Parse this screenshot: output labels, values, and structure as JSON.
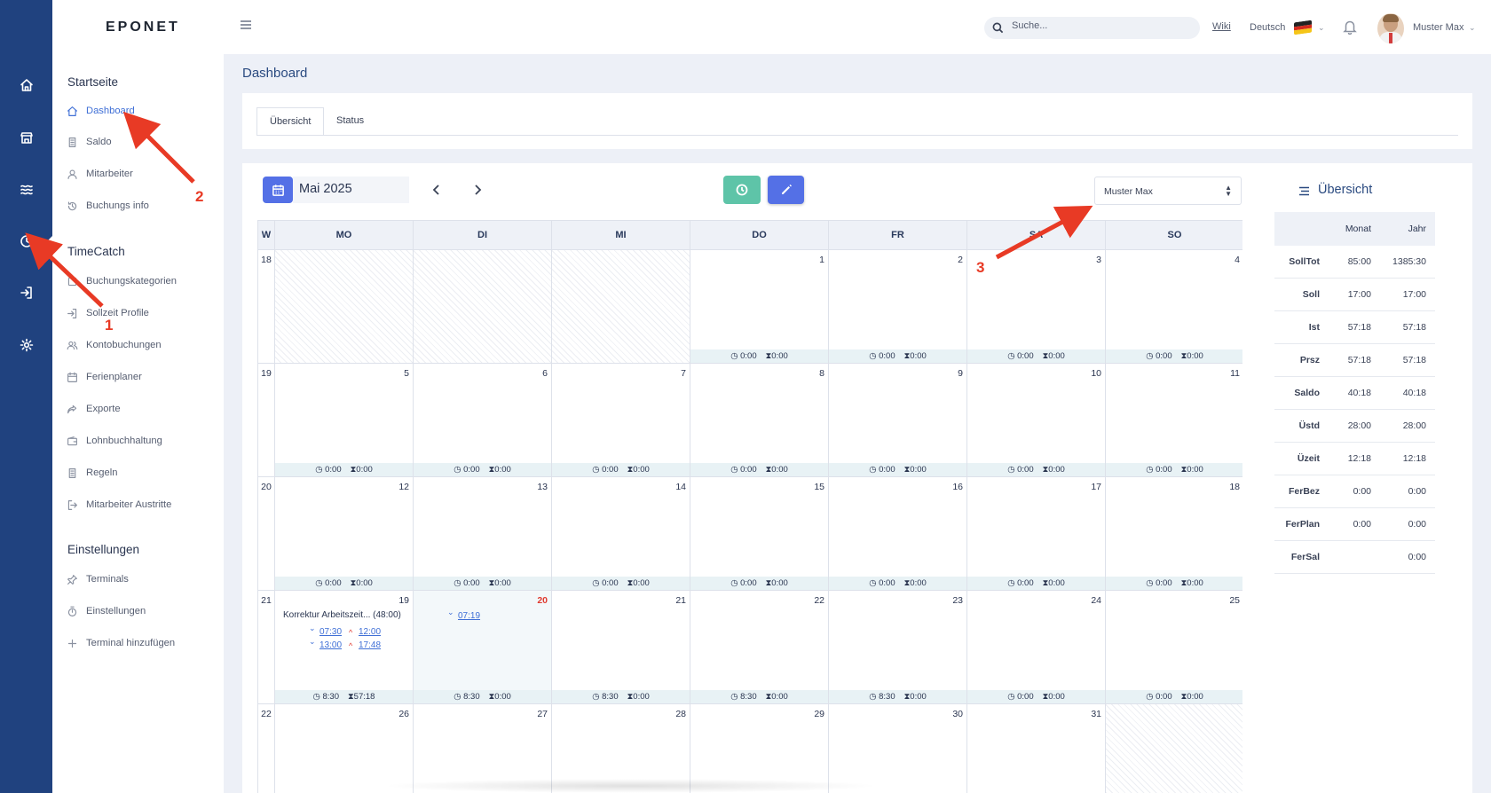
{
  "app": {
    "logo": "EPONET"
  },
  "header": {
    "search_placeholder": "Suche...",
    "wiki": "Wiki",
    "language": "Deutsch",
    "user": "Muster Max"
  },
  "sidebar": {
    "groups": [
      {
        "title": "Startseite",
        "items": [
          {
            "label": "Dashboard",
            "icon": "home-icon",
            "active": true
          },
          {
            "label": "Saldo",
            "icon": "document-icon"
          },
          {
            "label": "Mitarbeiter",
            "icon": "person-icon"
          },
          {
            "label": "Buchungs info",
            "icon": "history-icon"
          }
        ]
      },
      {
        "title": "TimeCatch",
        "items": [
          {
            "label": "Buchungskategorien",
            "icon": "checkbox-icon"
          },
          {
            "label": "Sollzeit Profile",
            "icon": "login-icon"
          },
          {
            "label": "Kontobuchungen",
            "icon": "users-icon"
          },
          {
            "label": "Ferienplaner",
            "icon": "calendar-icon"
          },
          {
            "label": "Exporte",
            "icon": "share-icon"
          },
          {
            "label": "Lohnbuchhaltung",
            "icon": "wallet-icon"
          },
          {
            "label": "Regeln",
            "icon": "document-icon"
          },
          {
            "label": "Mitarbeiter Austritte",
            "icon": "logout-icon"
          }
        ]
      },
      {
        "title": "Einstellungen",
        "items": [
          {
            "label": "Terminals",
            "icon": "pin-icon"
          },
          {
            "label": "Einstellungen",
            "icon": "timer-icon"
          },
          {
            "label": "Terminal hinzufügen",
            "icon": "plus-icon"
          }
        ]
      }
    ]
  },
  "page": {
    "title": "Dashboard"
  },
  "tabs": [
    {
      "label": "Übersicht",
      "selected": true
    },
    {
      "label": "Status"
    }
  ],
  "calendar": {
    "month": "Mai 2025",
    "selected_user": "Muster Max",
    "headers": [
      "W",
      "MO",
      "DI",
      "MI",
      "DO",
      "FR",
      "SA",
      "SO"
    ],
    "weeks": [
      {
        "wk": "18",
        "days": [
          {
            "out": true
          },
          {
            "out": true
          },
          {
            "out": true
          },
          {
            "d": "1",
            "a": "0:00",
            "b": "0:00"
          },
          {
            "d": "2",
            "a": "0:00",
            "b": "0:00"
          },
          {
            "d": "3",
            "a": "0:00",
            "b": "0:00"
          },
          {
            "d": "4",
            "a": "0:00",
            "b": "0:00"
          }
        ]
      },
      {
        "wk": "19",
        "days": [
          {
            "d": "5",
            "a": "0:00",
            "b": "0:00"
          },
          {
            "d": "6",
            "a": "0:00",
            "b": "0:00"
          },
          {
            "d": "7",
            "a": "0:00",
            "b": "0:00"
          },
          {
            "d": "8",
            "a": "0:00",
            "b": "0:00"
          },
          {
            "d": "9",
            "a": "0:00",
            "b": "0:00"
          },
          {
            "d": "10",
            "a": "0:00",
            "b": "0:00"
          },
          {
            "d": "11",
            "a": "0:00",
            "b": "0:00"
          }
        ]
      },
      {
        "wk": "20",
        "days": [
          {
            "d": "12",
            "a": "0:00",
            "b": "0:00"
          },
          {
            "d": "13",
            "a": "0:00",
            "b": "0:00"
          },
          {
            "d": "14",
            "a": "0:00",
            "b": "0:00"
          },
          {
            "d": "15",
            "a": "0:00",
            "b": "0:00"
          },
          {
            "d": "16",
            "a": "0:00",
            "b": "0:00"
          },
          {
            "d": "17",
            "a": "0:00",
            "b": "0:00"
          },
          {
            "d": "18",
            "a": "0:00",
            "b": "0:00"
          }
        ]
      },
      {
        "wk": "21",
        "days": [
          {
            "d": "19",
            "a": "8:30",
            "b": "57:18",
            "entry": "Korrektur Arbeitszeit... (48:00)",
            "times": [
              [
                "07:30",
                "12:00"
              ],
              [
                "13:00",
                "17:48"
              ]
            ]
          },
          {
            "d": "20",
            "a": "8:30",
            "b": "0:00",
            "today": true,
            "times": [
              [
                "07:19",
                ""
              ]
            ]
          },
          {
            "d": "21",
            "a": "8:30",
            "b": "0:00"
          },
          {
            "d": "22",
            "a": "8:30",
            "b": "0:00"
          },
          {
            "d": "23",
            "a": "8:30",
            "b": "0:00"
          },
          {
            "d": "24",
            "a": "0:00",
            "b": "0:00"
          },
          {
            "d": "25",
            "a": "0:00",
            "b": "0:00"
          }
        ]
      },
      {
        "wk": "22",
        "days": [
          {
            "d": "26"
          },
          {
            "d": "27"
          },
          {
            "d": "28"
          },
          {
            "d": "29"
          },
          {
            "d": "30"
          },
          {
            "d": "31"
          },
          {
            "out": true
          }
        ]
      }
    ]
  },
  "overview": {
    "title": "Übersicht",
    "col_month": "Monat",
    "col_year": "Jahr",
    "rows": [
      {
        "k": "SollTot",
        "m": "85:00",
        "y": "1385:30"
      },
      {
        "k": "Soll",
        "m": "17:00",
        "y": "17:00"
      },
      {
        "k": "Ist",
        "m": "57:18",
        "y": "57:18"
      },
      {
        "k": "Prsz",
        "m": "57:18",
        "y": "57:18"
      },
      {
        "k": "Saldo",
        "m": "40:18",
        "y": "40:18"
      },
      {
        "k": "Üstd",
        "m": "28:00",
        "y": "28:00"
      },
      {
        "k": "Üzeit",
        "m": "12:18",
        "y": "12:18"
      },
      {
        "k": "FerBez",
        "m": "0:00",
        "y": "0:00"
      },
      {
        "k": "FerPlan",
        "m": "0:00",
        "y": "0:00"
      },
      {
        "k": "FerSal",
        "m": "",
        "y": "0:00"
      }
    ]
  },
  "annotations": [
    {
      "label": "1"
    },
    {
      "label": "2"
    },
    {
      "label": "3"
    }
  ],
  "colors": {
    "rail": "#20427f",
    "accent": "#5470e6",
    "teal": "#5ec4a8",
    "annotation": "#e83a25"
  }
}
